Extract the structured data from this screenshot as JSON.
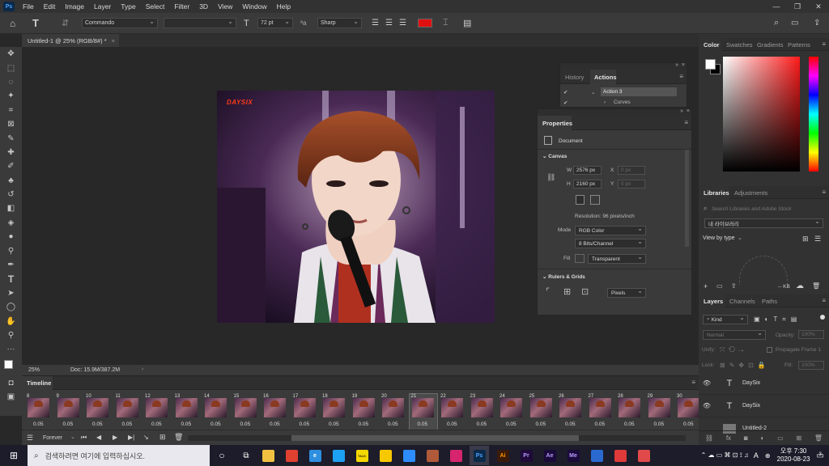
{
  "menubar": {
    "app_logo": "Ps",
    "items": [
      "File",
      "Edit",
      "Image",
      "Layer",
      "Type",
      "Select",
      "Filter",
      "3D",
      "View",
      "Window",
      "Help"
    ]
  },
  "options": {
    "font_family": "Commando",
    "font_style": "",
    "font_size": "72 pt",
    "antialias": "Sharp",
    "color": "#e01010"
  },
  "document": {
    "tab_title": "Untitled-1 @ 25% (RGB/8#) *",
    "zoom": "25%",
    "doc_info": "Doc: 15.9M/387.2M"
  },
  "photo": {
    "watermark": "DAYSIX"
  },
  "history": {
    "tabs": [
      "History",
      "Actions"
    ],
    "active": "Actions",
    "rows": [
      "Action 3",
      "Curves"
    ]
  },
  "properties": {
    "title": "Properties",
    "doc_label": "Document",
    "canvas": {
      "section": "Canvas",
      "w_label": "W",
      "w_value": "2576 px",
      "h_label": "H",
      "h_value": "2160 px",
      "x_label": "X",
      "x_value": "0 px",
      "y_label": "Y",
      "y_value": "0 px",
      "resolution": "Resolution: 96 pixels/inch",
      "mode_label": "Mode",
      "mode_value": "RGB Color",
      "bits_value": "8 Bits/Channel",
      "fill_label": "Fill",
      "fill_value": "Transparent"
    },
    "rulers": {
      "section": "Rulers & Grids",
      "unit": "Pixels"
    }
  },
  "color_panel": {
    "tabs": [
      "Color",
      "Swatches",
      "Gradients",
      "Patterns"
    ],
    "active": "Color",
    "fg": "#ffffff",
    "bg": "#000000",
    "hue": "#ff1a1a"
  },
  "libraries": {
    "tabs": [
      "Libraries",
      "Adjustments"
    ],
    "active": "Libraries",
    "search_placeholder": "Search Libraries and Adobe Stock",
    "library_select": "내 라이브러리",
    "view_by": "View by type",
    "size": "-- KB"
  },
  "layers": {
    "tabs": [
      "Layers",
      "Channels",
      "Paths"
    ],
    "active": "Layers",
    "filter": "Kind",
    "blend": "Normal",
    "opacity_label": "Opacity:",
    "opacity_value": "100%",
    "unify_label": "Unify:",
    "propagate": "Propagate Frame 1",
    "lock_label": "Lock:",
    "fill_label": "Fill:",
    "fill_value": "100%",
    "items": [
      {
        "name": "DaySix",
        "type": "text"
      },
      {
        "name": "DaySix",
        "type": "text"
      },
      {
        "name": "Untitled-2",
        "type": "image"
      }
    ]
  },
  "timeline": {
    "title": "Timeline",
    "loop": "Forever",
    "frames": [
      {
        "n": "8",
        "d": "0.05"
      },
      {
        "n": "9",
        "d": "0.05"
      },
      {
        "n": "10",
        "d": "0.05"
      },
      {
        "n": "11",
        "d": "0.05"
      },
      {
        "n": "12",
        "d": "0.05"
      },
      {
        "n": "13",
        "d": "0.05"
      },
      {
        "n": "14",
        "d": "0.05"
      },
      {
        "n": "15",
        "d": "0.05"
      },
      {
        "n": "16",
        "d": "0.05"
      },
      {
        "n": "17",
        "d": "0.05"
      },
      {
        "n": "18",
        "d": "0.05"
      },
      {
        "n": "19",
        "d": "0.05"
      },
      {
        "n": "20",
        "d": "0.05"
      },
      {
        "n": "21",
        "d": "0.05"
      },
      {
        "n": "22",
        "d": "0.05"
      },
      {
        "n": "23",
        "d": "0.05"
      },
      {
        "n": "24",
        "d": "0.05"
      },
      {
        "n": "25",
        "d": "0.05"
      },
      {
        "n": "26",
        "d": "0.05"
      },
      {
        "n": "27",
        "d": "0.05"
      },
      {
        "n": "28",
        "d": "0.05"
      },
      {
        "n": "29",
        "d": "0.05"
      },
      {
        "n": "30",
        "d": "0.05"
      }
    ],
    "active_frame": "21"
  },
  "taskbar": {
    "search_placeholder": "검색하려면 여기에 입력하십시오.",
    "time": "오후 7:30",
    "date": "2020-08-23",
    "ime": "A",
    "notify_count": "3",
    "apps": [
      {
        "label": "Explorer",
        "color": "#f0c040",
        "text": ""
      },
      {
        "label": "Chrome",
        "color": "#e04030",
        "text": ""
      },
      {
        "label": "Edge",
        "color": "#2e8ee0",
        "text": "e"
      },
      {
        "label": "Twitter",
        "color": "#1da1f2",
        "text": ""
      },
      {
        "label": "KakaoTalk",
        "color": "#f5d800",
        "text": "TALK"
      },
      {
        "label": "Sticky",
        "color": "#f7c800",
        "text": ""
      },
      {
        "label": "Zoom",
        "color": "#2d8cff",
        "text": ""
      },
      {
        "label": "App1",
        "color": "#b05a3a",
        "text": ""
      },
      {
        "label": "Instagram",
        "color": "#d6246e",
        "text": ""
      },
      {
        "label": "Photoshop",
        "color": "#0b2a4a",
        "text": "Ps"
      },
      {
        "label": "Illustrator",
        "color": "#3a1a0a",
        "text": "Ai"
      },
      {
        "label": "Premiere",
        "color": "#1f0a3a",
        "text": "Pr"
      },
      {
        "label": "After Effects",
        "color": "#1a0a3a",
        "text": "Ae"
      },
      {
        "label": "Media Encoder",
        "color": "#1a0a3a",
        "text": "Me"
      },
      {
        "label": "Game",
        "color": "#2a6ad0",
        "text": ""
      },
      {
        "label": "App2",
        "color": "#e03a3a",
        "text": ""
      },
      {
        "label": "App3",
        "color": "#e04a4a",
        "text": ""
      }
    ]
  }
}
